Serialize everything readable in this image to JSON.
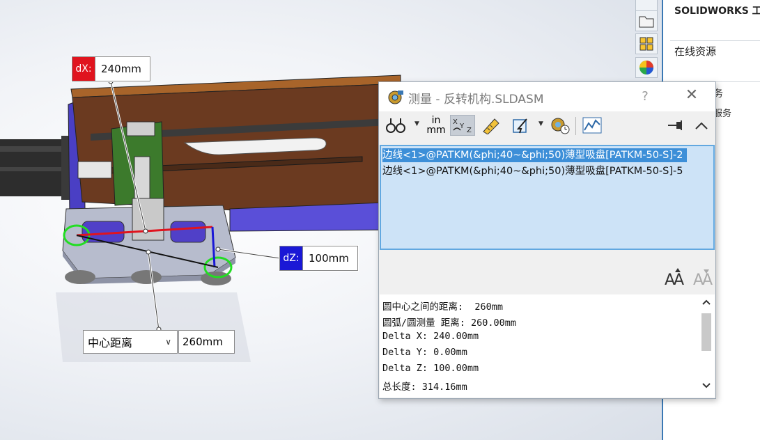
{
  "viewport": {
    "dx_tag": "dX:",
    "dx_value": "240mm",
    "dz_tag": "dZ:",
    "dz_value": "100mm",
    "measure_type": "中心距离",
    "center_value": "260mm",
    "colors": {
      "dx": "#e0141e",
      "dz": "#1a18d6",
      "model_top": "#6b3a20",
      "model_side": "#5a4fd8",
      "base_plate": "#b7bccd"
    }
  },
  "taskpane": {
    "title": "SOLIDWORKS 工",
    "online_resources": "在线资源",
    "frag1": "务",
    "frag2": "服务",
    "icons": [
      "home-icon",
      "folder-icon",
      "design-library-icon",
      "appearance-icon"
    ]
  },
  "dialog": {
    "title": "测量 - 反转机构.SLDASM",
    "help": "?",
    "close": "✕",
    "toolbar": {
      "units_top": "in",
      "units_bottom": "mm",
      "icons": [
        "arc-circle-measure-icon",
        "units-precision-icon",
        "show-xyz-icon",
        "point-to-point-icon",
        "projected-on-icon",
        "measurement-history-icon",
        "create-sensor-icon",
        "keep-visible-pin-icon",
        "collapse-chevron-icon"
      ]
    },
    "entities": [
      "边线<1>@PATKM(&phi;40~&phi;50)薄型吸盘[PATKM-50-S]-2",
      "边线<1>@PATKM(&phi;40~&phi;50)薄型吸盘[PATKM-50-S]-5"
    ],
    "results": [
      "圆中心之间的距离:  260mm",
      "圆弧/圆测量 距离: 260.00mm",
      "Delta X: 240.00mm",
      "Delta Y: 0.00mm",
      "Delta Z: 100.00mm",
      "总长度: 314.16mm"
    ]
  }
}
